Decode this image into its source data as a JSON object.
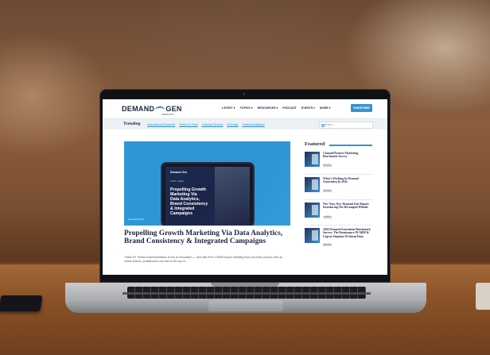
{
  "site": {
    "logo_main": "DEMAND",
    "logo_gen": "GEN",
    "logo_sub": "REPORT",
    "nav": [
      "LATEST ▾",
      "TOPICS ▾",
      "RESOURCES ▾",
      "PODCAST",
      "EVENTS ▾",
      "MORE ▾"
    ],
    "subscribe_label": "SUBSCRIBE"
  },
  "trending": {
    "label": "Trending",
    "links": [
      "Informational Framework",
      "Pipeline AI Tools",
      "Customer Success",
      "AI Analyst",
      "Content Intelligence"
    ],
    "search_placeholder": "Search..."
  },
  "hero": {
    "tablet_logo": "Demand Gen",
    "tablet_kicker": "STUDY HERE",
    "tablet_title": "Propelling Growth\nMarketing Via\nData Analytics,\nBrand Consistency\n& Integrated\nCampaigns",
    "tag": "Editorial Series",
    "article_title": "Propelling Growth Marketing Via Data Analytics, Brand Consistency & Integrated Campaigns",
    "article_excerpt": "\"State Of\" Series Experimentation is key to innovation — and with 90% of B2B buyers initiating their purchase journey with an online search, practitioners can rise to the top of…"
  },
  "featured": {
    "heading": "Featured",
    "items": [
      {
        "title": "Channel/Partner Marketing Benchmark Survey",
        "tag": "REPORTS"
      },
      {
        "title": "What's Working In Demand Generation In 2024",
        "tag": "REPORTS"
      },
      {
        "title": "New Year, New Demand Gen Report: Introducing The Revamped Website",
        "tag": "NEWS"
      },
      {
        "title": "2024 Demand Generation Benchmark Survey: The Renaissance Of ABM & Urgent Adoption Of Intent Data",
        "tag": "REPORTS"
      }
    ]
  },
  "colors": {
    "accent": "#2c8ecf",
    "navy": "#1b2340",
    "hero_bg": "#2d97d6"
  }
}
